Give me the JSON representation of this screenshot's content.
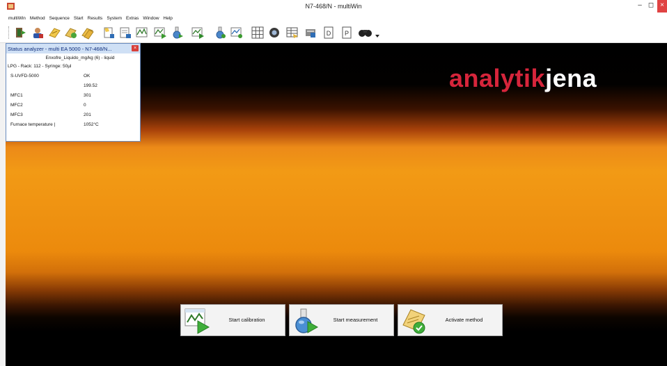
{
  "window": {
    "title": "N7-468/N - multiWin",
    "minimize": "–",
    "maximize": "◻",
    "close": "×"
  },
  "menu": [
    "multiWin",
    "Method",
    "Sequence",
    "Start",
    "Results",
    "System",
    "Extras",
    "Window",
    "Help"
  ],
  "toolbar": {
    "icons": [
      "exit-icon",
      "user-icon",
      "method-icon",
      "sequence-icon",
      "sample-icon",
      "calibration-icon",
      "measurement-icon",
      "chart-icon",
      "results-icon",
      "flask-icon",
      "report-icon",
      "flask-icon-2",
      "report-icon-2",
      "grid-icon",
      "furnace-icon",
      "table-icon",
      "database-icon",
      "document-d-icon",
      "document-p-icon",
      "binoculars-icon"
    ]
  },
  "brand": {
    "part1": "analytik",
    "part2": "jena",
    "color1": "#d6253b",
    "color2": "#ffffff"
  },
  "status_window": {
    "title": "Status analyzer - multi EA 5000 - N7-468/N...",
    "close": "×",
    "sample": "Enxofre_Liquido_mg/kg (6) - liquid",
    "rack_line": "LPG - Rack: 112 - Syringe: 50µl",
    "rows": [
      {
        "label": "S-UVFD-5000",
        "value": "OK"
      },
      {
        "label": "",
        "value": "199.52"
      },
      {
        "label": "MFC1",
        "value": "301"
      },
      {
        "label": "MFC2",
        "value": "0"
      },
      {
        "label": "MFC3",
        "value": "201"
      },
      {
        "label": "Furnace temperature |",
        "value": "1052°C"
      }
    ]
  },
  "actions": {
    "calibration": "Start calibration",
    "measurement": "Start measurement",
    "activate": "Activate method"
  }
}
